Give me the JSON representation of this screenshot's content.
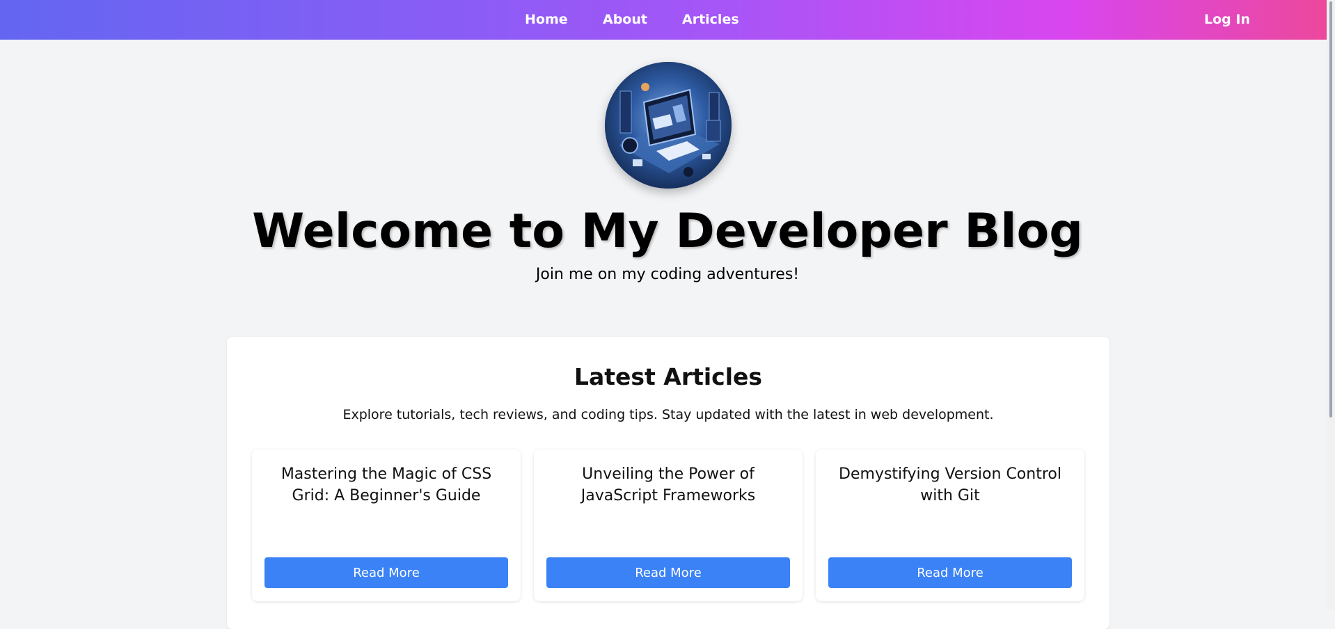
{
  "nav": {
    "links": [
      "Home",
      "About",
      "Articles"
    ],
    "login_label": "Log In"
  },
  "hero": {
    "title": "Welcome to My Developer Blog",
    "subtitle": "Join me on my coding adventures!"
  },
  "articles": {
    "title": "Latest Articles",
    "subtitle": "Explore tutorials, tech reviews, and coding tips. Stay updated with the latest in web development.",
    "cards": [
      {
        "title": "Mastering the Magic of CSS Grid: A Beginner's Guide",
        "button_label": "Read More"
      },
      {
        "title": "Unveiling the Power of JavaScript Frameworks",
        "button_label": "Read More"
      },
      {
        "title": "Demystifying Version Control with Git",
        "button_label": "Read More"
      }
    ]
  },
  "colors": {
    "nav_gradient_start": "#6366f1",
    "nav_gradient_end": "#ec4899",
    "button": "#3b82f6",
    "page_background": "#f3f4f6"
  }
}
